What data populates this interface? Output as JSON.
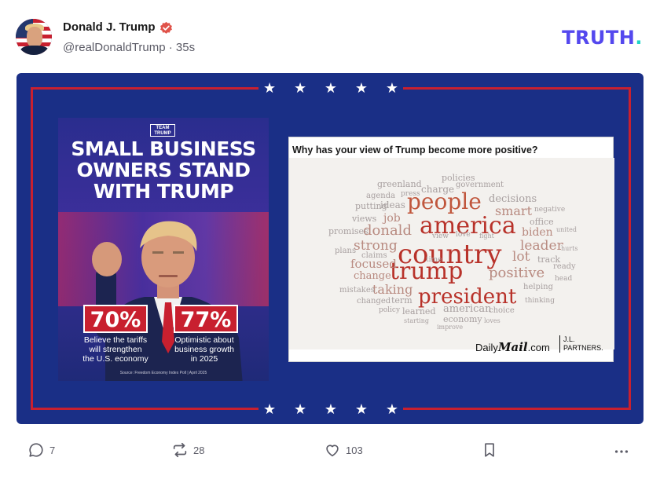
{
  "post": {
    "author_name": "Donald J. Trump",
    "handle": "@realDonaldTrump",
    "separator": "·",
    "time_ago": "35s",
    "verified_icon": "verified-badge-icon",
    "brand_logo_text": "TRUTH",
    "brand_logo_dot": "."
  },
  "colors": {
    "brand_purple": "#5448ee",
    "brand_teal": "#1fd4c7",
    "media_blue": "#1a2f86",
    "frame_red": "#c8202f",
    "verified_red": "#e0534a"
  },
  "poster": {
    "badge_line1": "TEAM",
    "badge_line2": "TRUMP",
    "title": "SMALL BUSINESS\nOWNERS STAND\nWITH TRUMP",
    "stat1_value": "70%",
    "stat1_caption": "Believe the tariffs\nwill strengthen\nthe U.S. economy",
    "stat2_value": "77%",
    "stat2_caption": "Optimistic about\nbusiness growth\nin 2025",
    "source": "Source: Freedom Economy Index Poll | April 2025"
  },
  "wordcloud": {
    "question": "Why has your view of Trump become more positive?",
    "words": [
      {
        "t": "country",
        "color": "#b8322a"
      },
      {
        "t": "america",
        "color": "#b8322a"
      },
      {
        "t": "trump",
        "color": "#b8322a"
      },
      {
        "t": "president",
        "color": "#b8322a"
      },
      {
        "t": "people",
        "color": "#c0563c"
      },
      {
        "t": "donald",
        "color": "#b88a80"
      },
      {
        "t": "strong",
        "color": "#b88a80"
      },
      {
        "t": "positive",
        "color": "#b88a80"
      },
      {
        "t": "leader",
        "color": "#b88a80"
      },
      {
        "t": "focused",
        "color": "#b88a80"
      },
      {
        "t": "change",
        "color": "#b88a80"
      },
      {
        "t": "taking",
        "color": "#b88a80"
      },
      {
        "t": "biden",
        "color": "#b88a80"
      },
      {
        "t": "job",
        "color": "#b88a80"
      },
      {
        "t": "lot",
        "color": "#b88a80"
      },
      {
        "t": "smart",
        "color": "#b88a80"
      },
      {
        "t": "decisions",
        "color": "#a8a0a0"
      },
      {
        "t": "american",
        "color": "#a8a0a0"
      },
      {
        "t": "policies",
        "color": "#a8a0a0"
      },
      {
        "t": "charge",
        "color": "#a8a0a0"
      },
      {
        "t": "government",
        "color": "#a8a0a0"
      },
      {
        "t": "greenland",
        "color": "#a8a0a0"
      },
      {
        "t": "ideas",
        "color": "#a8a0a0"
      },
      {
        "t": "putting",
        "color": "#a8a0a0"
      },
      {
        "t": "agenda",
        "color": "#a8a0a0"
      },
      {
        "t": "press",
        "color": "#a8a0a0"
      },
      {
        "t": "views",
        "color": "#a8a0a0"
      },
      {
        "t": "promises",
        "color": "#a8a0a0"
      },
      {
        "t": "plans",
        "color": "#a8a0a0"
      },
      {
        "t": "claims",
        "color": "#a8a0a0"
      },
      {
        "t": "mistakes",
        "color": "#a8a0a0"
      },
      {
        "t": "changed",
        "color": "#a8a0a0"
      },
      {
        "t": "term",
        "color": "#a8a0a0"
      },
      {
        "t": "learned",
        "color": "#a8a0a0"
      },
      {
        "t": "economy",
        "color": "#a8a0a0"
      },
      {
        "t": "choice",
        "color": "#a8a0a0"
      },
      {
        "t": "helping",
        "color": "#a8a0a0"
      },
      {
        "t": "thinking",
        "color": "#a8a0a0"
      },
      {
        "t": "office",
        "color": "#a8a0a0"
      },
      {
        "t": "negative",
        "color": "#a8a0a0"
      },
      {
        "t": "track",
        "color": "#a8a0a0"
      },
      {
        "t": "ready",
        "color": "#a8a0a0"
      },
      {
        "t": "head",
        "color": "#a8a0a0"
      },
      {
        "t": "policy",
        "color": "#a8a0a0"
      },
      {
        "t": "starting",
        "color": "#a8a0a0"
      },
      {
        "t": "improve",
        "color": "#a8a0a0"
      },
      {
        "t": "loves",
        "color": "#a8a0a0"
      },
      {
        "t": "view",
        "color": "#a8a0a0"
      },
      {
        "t": "love",
        "color": "#a8a0a0"
      },
      {
        "t": "fight",
        "color": "#a8a0a0"
      },
      {
        "t": "time",
        "color": "#a8a0a0"
      },
      {
        "t": "united",
        "color": "#a8a0a0"
      },
      {
        "t": "hurts",
        "color": "#a8a0a0"
      }
    ],
    "brand_daily": "Daily",
    "brand_mail": "Mail",
    "brand_com": ".com",
    "partners": "J.L.\nPARTNERS."
  },
  "actions": {
    "reply_count": "7",
    "retruth_count": "28",
    "like_count": "103",
    "reply_icon": "reply-icon",
    "retruth_icon": "retruth-icon",
    "like_icon": "heart-icon",
    "bookmark_icon": "bookmark-icon",
    "more_icon": "more-icon"
  }
}
